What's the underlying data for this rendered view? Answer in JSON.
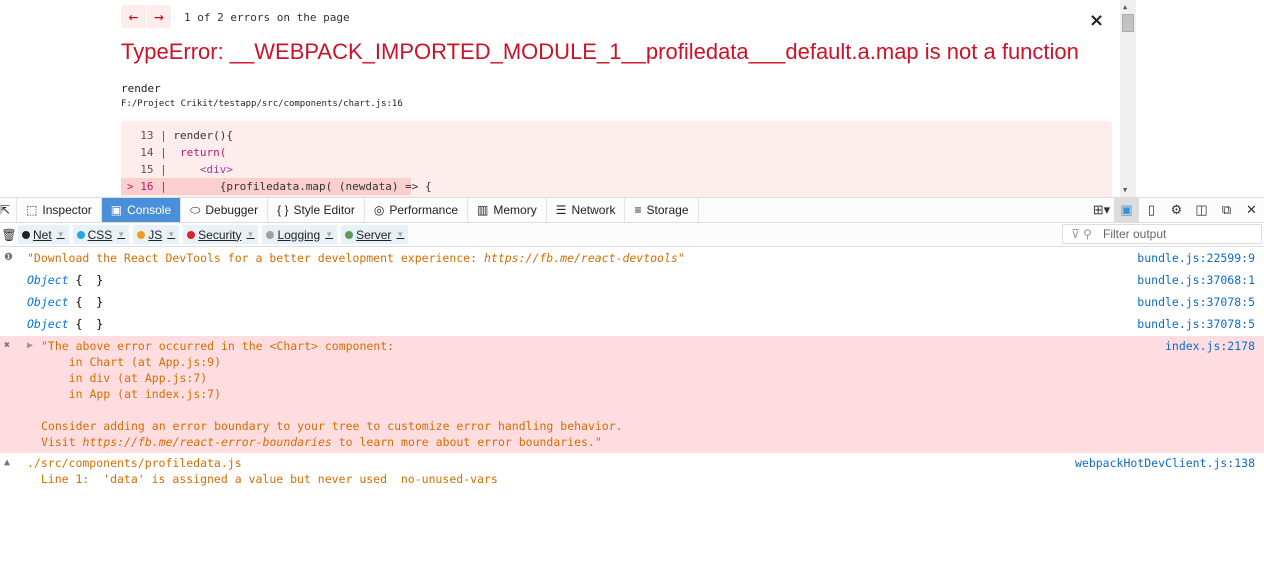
{
  "overlay": {
    "nav_prev": "←",
    "nav_next": "→",
    "error_count": "1 of 2 errors on the page",
    "close": "×",
    "title": "TypeError: __WEBPACK_IMPORTED_MODULE_1__profiledata___default.a.map is not a function",
    "function": "render",
    "file": "F:/Project Crikit/testapp/src/components/chart.js:16",
    "code": [
      {
        "ln": "  13 | ",
        "text": "render(){"
      },
      {
        "ln": "  14 | ",
        "text": " return("
      },
      {
        "ln": "  15 | ",
        "text": "    <div>"
      },
      {
        "ln": "> 16 | ",
        "text": "       {profiledata.map( (newdata) => {"
      }
    ]
  },
  "toolbar": {
    "tabs": [
      {
        "label": "Inspector",
        "icon": "inspector-icon",
        "glyph": "⬚"
      },
      {
        "label": "Console",
        "icon": "console-icon",
        "glyph": "▣"
      },
      {
        "label": "Debugger",
        "icon": "debugger-icon",
        "glyph": "⬭"
      },
      {
        "label": "Style Editor",
        "icon": "style-editor-icon",
        "glyph": "{ }"
      },
      {
        "label": "Performance",
        "icon": "performance-icon",
        "glyph": "◎"
      },
      {
        "label": "Memory",
        "icon": "memory-icon",
        "glyph": "▥"
      },
      {
        "label": "Network",
        "icon": "network-icon",
        "glyph": "☰"
      },
      {
        "label": "Storage",
        "icon": "storage-icon",
        "glyph": "≡"
      }
    ],
    "active_tab": "Console"
  },
  "filters": {
    "chips": [
      {
        "label": "Net",
        "color": "#222222"
      },
      {
        "label": "CSS",
        "color": "#1fa8e0"
      },
      {
        "label": "JS",
        "color": "#f29b1d"
      },
      {
        "label": "Security",
        "color": "#e0202e"
      },
      {
        "label": "Logging",
        "color": "#a0a0a0"
      },
      {
        "label": "Server",
        "color": "#5b9a58"
      }
    ],
    "filter_placeholder": "Filter output"
  },
  "messages": {
    "m1": {
      "text": "\"Download the React DevTools for a better development experience: ",
      "link": "https://fb.me/react-devtools",
      "end": "\"",
      "src": "bundle.js:22599:9"
    },
    "m2": {
      "obj": "Object",
      "rest": " {  }",
      "src": "bundle.js:37068:1"
    },
    "m3": {
      "obj": "Object",
      "rest": " {  }",
      "src": "bundle.js:37078:5"
    },
    "m4": {
      "obj": "Object",
      "rest": " {  }",
      "src": "bundle.js:37078:5"
    },
    "m5": {
      "text1": "\"The above error occurred in the <Chart> component:\n    in Chart (at App.js:9)\n    in div (at App.js:7)\n    in App (at index.js:7)\n\nConsider adding an error boundary to your tree to customize error handling behavior.\nVisit ",
      "link": "https://fb.me/react-error-boundaries",
      "text2": " to learn more about error boundaries.\"",
      "src": "index.js:2178"
    },
    "m6": {
      "text": "./src/components/profiledata.js\n  Line 1:  'data' is assigned a value but never used  no-unused-vars",
      "src": "webpackHotDevClient.js:138"
    }
  }
}
